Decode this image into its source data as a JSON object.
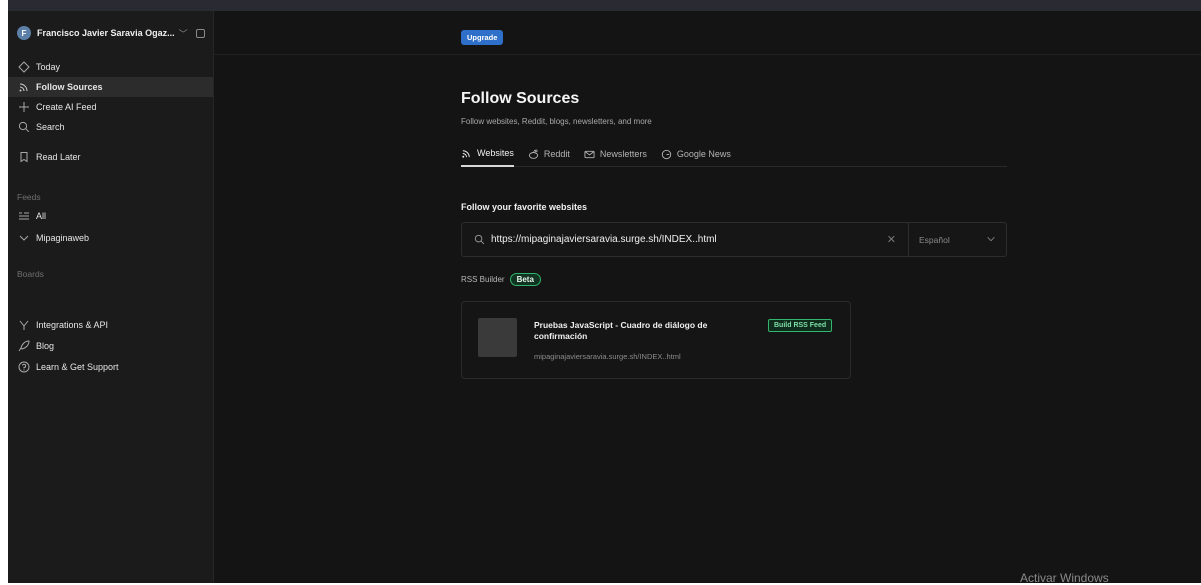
{
  "sidebar": {
    "user": {
      "initial": "F",
      "name": "Francisco Javier Saravia Ogaz..."
    },
    "nav": [
      {
        "label": "Today",
        "icon": "today-icon"
      },
      {
        "label": "Follow Sources",
        "icon": "rss-icon",
        "active": true
      },
      {
        "label": "Create AI Feed",
        "icon": "plus-icon"
      },
      {
        "label": "Search",
        "icon": "search-icon"
      },
      {
        "label": "Read Later",
        "icon": "bookmark-icon"
      }
    ],
    "feeds_label": "Feeds",
    "feeds": [
      {
        "label": "All",
        "icon": "list-icon"
      },
      {
        "label": "Mipaginaweb",
        "icon": "chevron-down-icon"
      }
    ],
    "boards_label": "Boards",
    "footer": [
      {
        "label": "Integrations & API",
        "icon": "plug-icon"
      },
      {
        "label": "Blog",
        "icon": "rocket-icon"
      },
      {
        "label": "Learn & Get Support",
        "icon": "help-icon"
      }
    ]
  },
  "topbar": {
    "upgrade_label": "Upgrade"
  },
  "main": {
    "title": "Follow Sources",
    "subtitle": "Follow websites, Reddit, blogs, newsletters, and more",
    "tabs": [
      {
        "label": "Websites",
        "icon": "rss-icon",
        "active": true
      },
      {
        "label": "Reddit",
        "icon": "reddit-icon"
      },
      {
        "label": "Newsletters",
        "icon": "mail-icon"
      },
      {
        "label": "Google News",
        "icon": "google-icon"
      }
    ],
    "section_heading": "Follow your favorite websites",
    "search": {
      "value": "https://mipaginajaviersaravia.surge.sh/INDEX..html",
      "language": "Español"
    },
    "rss_builder_label": "RSS Builder",
    "beta_label": "Beta",
    "result": {
      "title": "Pruebas JavaScript - Cuadro de diálogo de confirmación",
      "url": "mipaginajaviersaravia.surge.sh/INDEX..html",
      "build_label": "Build RSS Feed"
    }
  },
  "watermark": "Activar Windows",
  "colors": {
    "background": "#141414",
    "sidebar": "#1b1b1b",
    "accent_blue": "#2d6fc9",
    "accent_green": "#32b56d"
  }
}
